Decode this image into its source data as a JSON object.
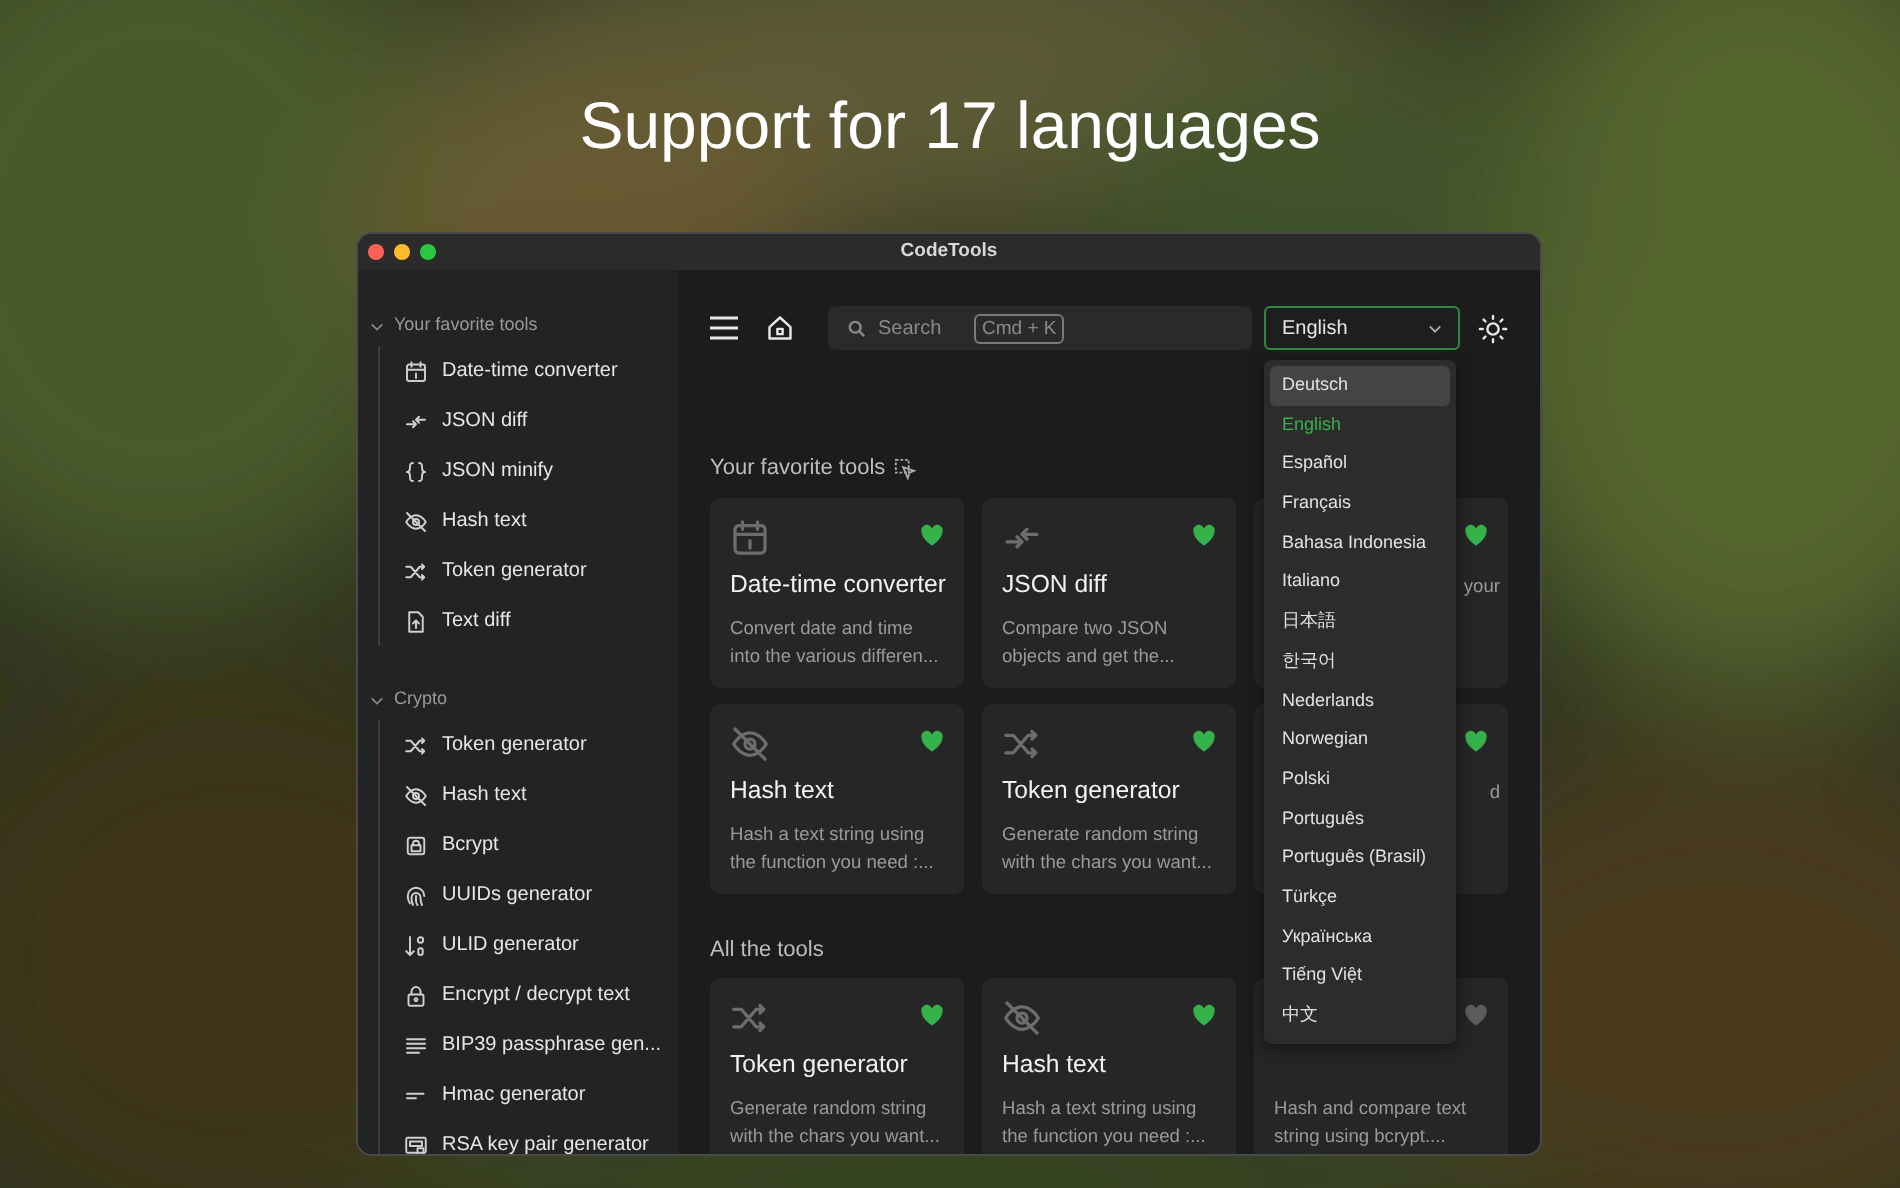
{
  "heading": "Support for 17 languages",
  "window": {
    "title": "CodeTools"
  },
  "sidebar": {
    "groups": [
      {
        "label": "Your favorite tools",
        "expanded": true,
        "items": [
          {
            "label": "Date-time converter",
            "kind": "calendar"
          },
          {
            "label": "JSON diff",
            "kind": "diff"
          },
          {
            "label": "JSON minify",
            "kind": "braces"
          },
          {
            "label": "Hash text",
            "kind": "eyeoff"
          },
          {
            "label": "Token generator",
            "kind": "shuffle"
          },
          {
            "label": "Text diff",
            "kind": "file"
          }
        ]
      },
      {
        "label": "Crypto",
        "expanded": true,
        "items": [
          {
            "label": "Token generator",
            "kind": "shuffle"
          },
          {
            "label": "Hash text",
            "kind": "eyeoff"
          },
          {
            "label": "Bcrypt",
            "kind": "badge"
          },
          {
            "label": "UUIDs generator",
            "kind": "fingerprint"
          },
          {
            "label": "ULID generator",
            "kind": "sort"
          },
          {
            "label": "Encrypt / decrypt text",
            "kind": "lock"
          },
          {
            "label": "BIP39 passphrase gen...",
            "kind": "lines"
          },
          {
            "label": "Hmac generator",
            "kind": "short"
          },
          {
            "label": "RSA key pair generator",
            "kind": "keycard"
          }
        ]
      }
    ]
  },
  "toolbar": {
    "search": {
      "placeholder": "Search",
      "shortcut": "Cmd + K"
    },
    "language": {
      "value": "English",
      "expanded": true,
      "options": [
        {
          "label": "Deutsch",
          "selected": false,
          "hovered": true
        },
        {
          "label": "English",
          "selected": true,
          "hovered": false
        },
        {
          "label": "Español",
          "selected": false,
          "hovered": false
        },
        {
          "label": "Français",
          "selected": false,
          "hovered": false
        },
        {
          "label": "Bahasa Indonesia",
          "selected": false,
          "hovered": false
        },
        {
          "label": "Italiano",
          "selected": false,
          "hovered": false
        },
        {
          "label": "日本語",
          "selected": false,
          "hovered": false
        },
        {
          "label": "한국어",
          "selected": false,
          "hovered": false
        },
        {
          "label": "Nederlands",
          "selected": false,
          "hovered": false
        },
        {
          "label": "Norwegian",
          "selected": false,
          "hovered": false
        },
        {
          "label": "Polski",
          "selected": false,
          "hovered": false
        },
        {
          "label": "Português",
          "selected": false,
          "hovered": false
        },
        {
          "label": "Português (Brasil)",
          "selected": false,
          "hovered": false
        },
        {
          "label": "Türkçe",
          "selected": false,
          "hovered": false
        },
        {
          "label": "Українська",
          "selected": false,
          "hovered": false
        },
        {
          "label": "Tiếng Việt",
          "selected": false,
          "hovered": false
        },
        {
          "label": "中文",
          "selected": false,
          "hovered": false
        }
      ]
    }
  },
  "sections": [
    {
      "title": "Your favorite tools",
      "cards": [
        {
          "kind": "calendar",
          "title": "Date-time converter",
          "description": "Convert date and time into the various differen...",
          "favorite": true
        },
        {
          "kind": "diff",
          "title": "JSON diff",
          "description": "Compare two JSON objects and get the...",
          "favorite": true
        },
        {
          "kind": "partial",
          "description": "your",
          "favorite": true
        },
        {
          "kind": "eyeoff",
          "title": "Hash text",
          "description": "Hash a text string using the function you need :...",
          "favorite": true
        },
        {
          "kind": "shuffle",
          "title": "Token generator",
          "description": "Generate random string with the chars you want...",
          "favorite": true
        },
        {
          "kind": "partial",
          "description": "d",
          "favorite": true
        }
      ]
    },
    {
      "title": "All the tools",
      "cards": [
        {
          "kind": "shuffle",
          "title": "Token generator",
          "description": "Generate random string with the chars you want...",
          "favorite": true
        },
        {
          "kind": "eyeoff",
          "title": "Hash text",
          "description": "Hash a text string using the function you need :...",
          "favorite": true
        },
        {
          "kind": "hidden",
          "description": "Hash and compare text string using bcrypt....",
          "favorite": false
        }
      ]
    }
  ]
}
